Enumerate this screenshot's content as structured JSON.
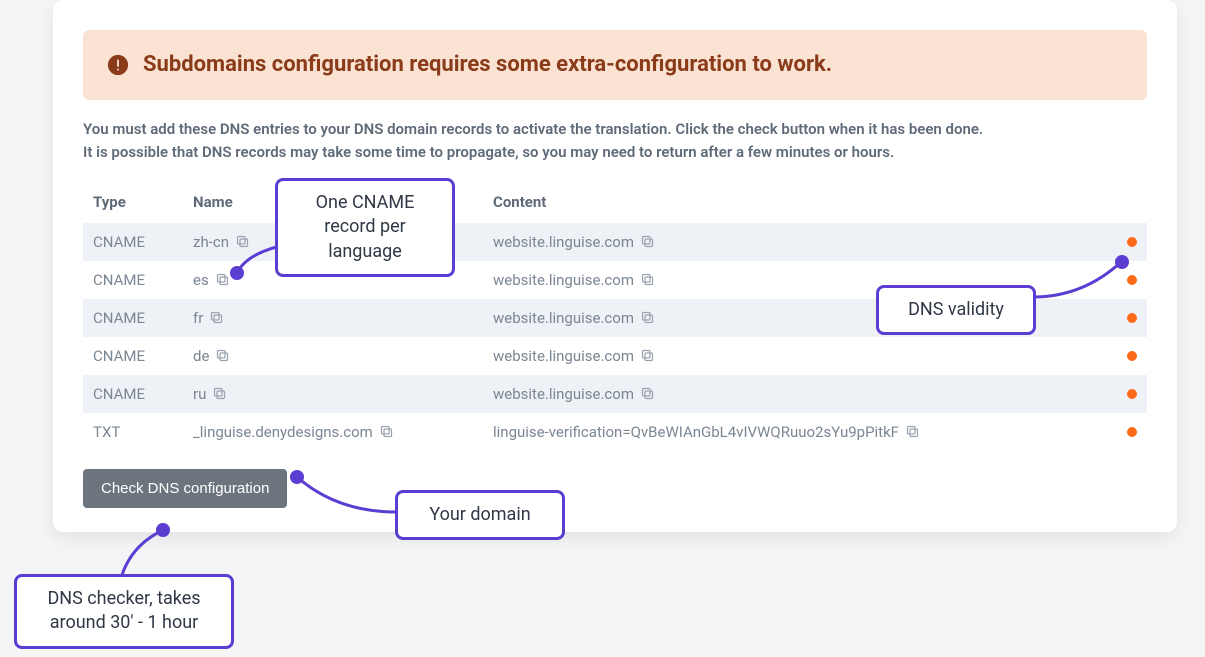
{
  "alert": {
    "title": "Subdomains configuration requires some extra-configuration to work."
  },
  "instructions": {
    "line1": "You must add these DNS entries to your DNS domain records to activate the translation. Click the check button when it has been done.",
    "line2": "It is possible that DNS records may take some time to propagate, so you may need to return after a few minutes or hours."
  },
  "table": {
    "headers": {
      "type": "Type",
      "name": "Name",
      "content": "Content"
    },
    "rows": [
      {
        "type": "CNAME",
        "name": "zh-cn",
        "content": "website.linguise.com",
        "status": "invalid"
      },
      {
        "type": "CNAME",
        "name": "es",
        "content": "website.linguise.com",
        "status": "invalid"
      },
      {
        "type": "CNAME",
        "name": "fr",
        "content": "website.linguise.com",
        "status": "invalid"
      },
      {
        "type": "CNAME",
        "name": "de",
        "content": "website.linguise.com",
        "status": "invalid"
      },
      {
        "type": "CNAME",
        "name": "ru",
        "content": "website.linguise.com",
        "status": "invalid"
      },
      {
        "type": "TXT",
        "name": "_linguise.denydesigns.com",
        "content": "linguise-verification=QvBeWIAnGbL4vIVWQRuuo2sYu9pPitkF",
        "status": "invalid"
      }
    ]
  },
  "button": {
    "check_dns": "Check DNS configuration"
  },
  "callouts": {
    "cname": "One CNAME record per language",
    "validity": "DNS validity",
    "domain": "Your domain",
    "checker": "DNS checker, takes around 30' - 1 hour"
  },
  "colors": {
    "accent_purple": "#5b3ed1",
    "status_invalid": "#ff6a1a",
    "alert_bg": "#fbe3d3",
    "alert_text": "#8a3b1a"
  }
}
